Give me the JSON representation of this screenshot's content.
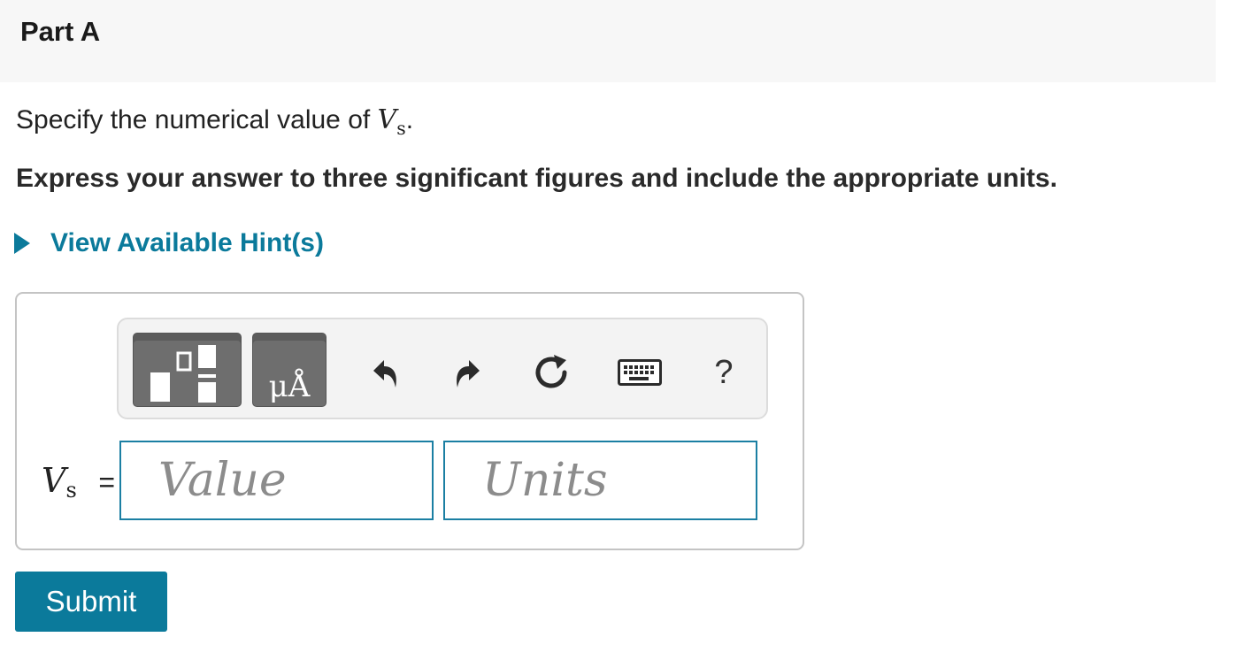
{
  "part": {
    "title": "Part A"
  },
  "question": {
    "prefix": "Specify the numerical value of ",
    "var_main": "V",
    "var_sub": "s",
    "suffix": "."
  },
  "instruction": "Express your answer to three significant figures and include the appropriate units.",
  "hint": {
    "label": "View Available Hint(s)"
  },
  "toolbar": {
    "units_button_label": "μÅ",
    "help_label": "?",
    "icons": [
      "templates-icon",
      "units-icon",
      "undo-icon",
      "redo-icon",
      "reset-icon",
      "keyboard-icon",
      "help-icon"
    ]
  },
  "answer": {
    "var_main": "V",
    "var_sub": "s",
    "equals": "=",
    "value_placeholder": "Value",
    "units_placeholder": "Units"
  },
  "submit": {
    "label": "Submit"
  },
  "colors": {
    "accent": "#0b7a9b",
    "field_border": "#1b7fa3",
    "header_bg": "#f7f7f7",
    "toolbar_bg": "#f3f3f3",
    "dark_button": "#6e6e6e"
  }
}
